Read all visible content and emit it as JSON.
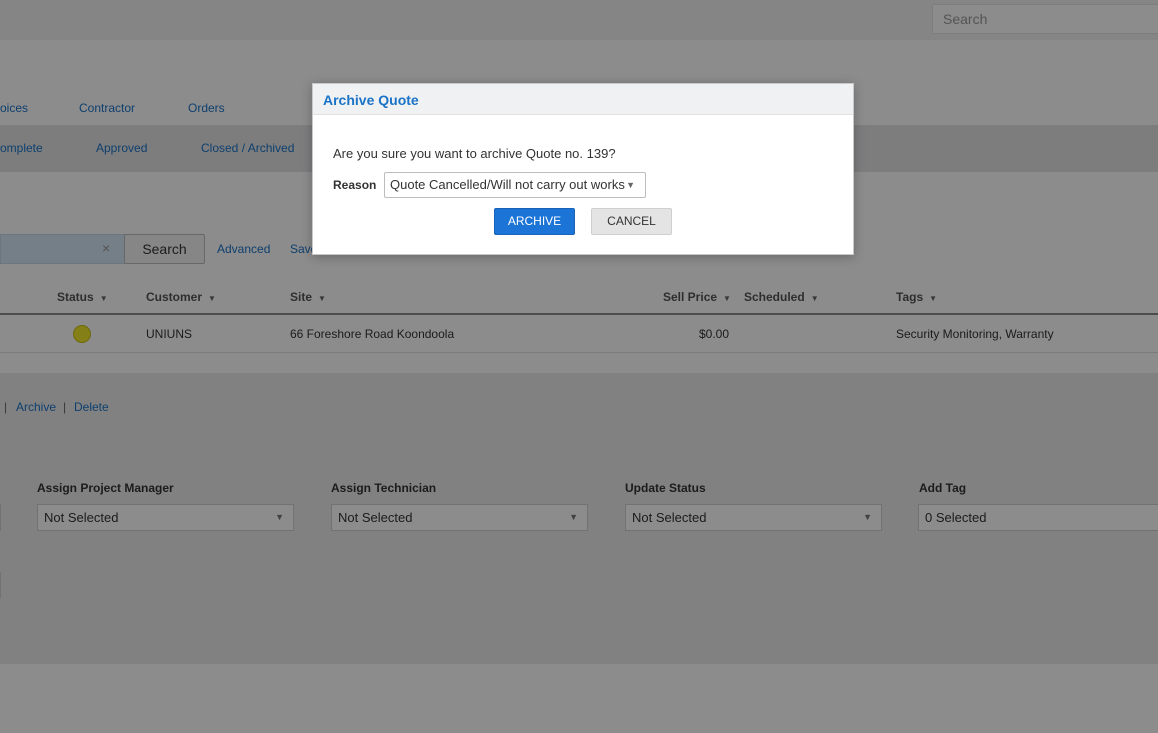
{
  "header": {
    "search_placeholder": "Search"
  },
  "nav_primary": [
    "oices",
    "Contractor",
    "Orders"
  ],
  "nav_secondary": [
    "omplete",
    "Approved",
    "Closed / Archived"
  ],
  "search": {
    "button_label": "Search",
    "clear_icon": "×",
    "advanced_label": "Advanced",
    "save_label": "Save"
  },
  "table": {
    "columns": [
      "Status",
      "Customer",
      "Site",
      "Sell Price",
      "Scheduled",
      "Tags"
    ],
    "rows": [
      {
        "status_color": "#f0e82b",
        "customer": "UNIUNS",
        "site": "66 Foreshore Road Koondoola",
        "sell_price": "$0.00",
        "scheduled": "",
        "tags": "Security Monitoring, Warranty"
      }
    ]
  },
  "row_actions": {
    "separator": "|",
    "archive_label": "Archive",
    "delete_label": "Delete"
  },
  "bulk": {
    "project_manager": {
      "label": "Assign Project Manager",
      "value": "Not Selected"
    },
    "technician": {
      "label": "Assign Technician",
      "value": "Not Selected"
    },
    "status": {
      "label": "Update Status",
      "value": "Not Selected"
    },
    "tag": {
      "label": "Add Tag",
      "value": "0 Selected"
    }
  },
  "modal": {
    "title": "Archive Quote",
    "message": "Are you sure you want to archive Quote no. 139?",
    "reason_label": "Reason",
    "reason_value": "Quote Cancelled/Will not carry out works",
    "archive_button": "ARCHIVE",
    "cancel_button": "CANCEL"
  },
  "icons": {
    "sort": "sort-down-icon",
    "dropdown": "caret-down-icon"
  }
}
